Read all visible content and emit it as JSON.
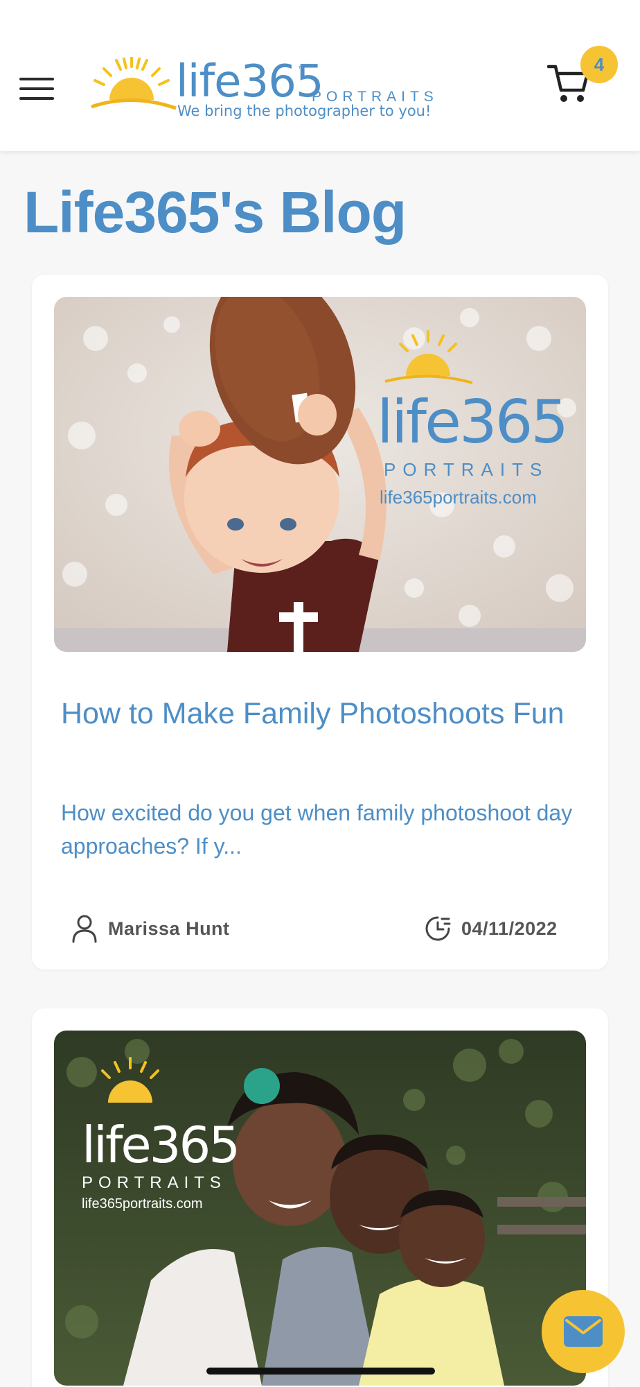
{
  "header": {
    "logo": {
      "brand": "life365",
      "trademark": "™",
      "subtitle": "PORTRAITS",
      "tagline": "We bring the photographer to you!"
    },
    "cart_count": "4"
  },
  "page": {
    "title": "Life365's Blog"
  },
  "posts": [
    {
      "image_watermark": {
        "brand": "life365",
        "subtitle": "PORTRAITS",
        "url": "life365portraits.com"
      },
      "title": "How to Make Family Photoshoots Fun",
      "excerpt": "How excited do you get when family photoshoot day approaches? If y...",
      "author": "Marissa Hunt",
      "date": "04/11/2022"
    },
    {
      "image_watermark": {
        "brand": "life365",
        "subtitle": "PORTRAITS",
        "url": "life365portraits.com"
      }
    }
  ],
  "colors": {
    "brand_blue": "#4d8ec6",
    "accent_yellow": "#f6c433"
  },
  "icons": [
    "menu-icon",
    "sun-logo-icon",
    "cart-icon",
    "user-icon",
    "clock-icon",
    "mail-icon"
  ]
}
